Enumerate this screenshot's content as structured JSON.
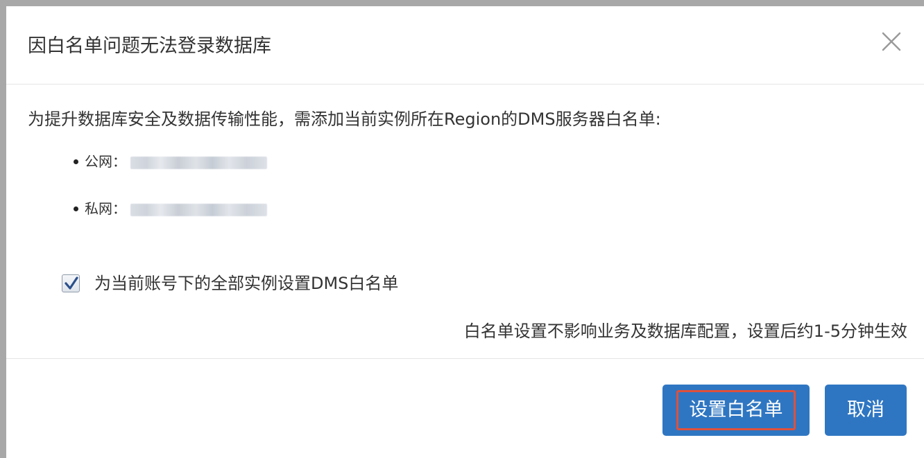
{
  "dialog": {
    "title": "因白名单问题无法登录数据库",
    "close_icon": "close-icon"
  },
  "body": {
    "intro": "为提升数据库安全及数据传输性能，需添加当前实例所在Region的DMS服务器白名单:",
    "ip_items": [
      {
        "label": "公网：",
        "value": ""
      },
      {
        "label": "私网：",
        "value": ""
      }
    ],
    "checkbox": {
      "label": "为当前账号下的全部实例设置DMS白名单",
      "checked": true
    },
    "note": "白名单设置不影响业务及数据库配置，设置后约1-5分钟生效"
  },
  "footer": {
    "confirm_label": "设置白名单",
    "cancel_label": "取消"
  },
  "colors": {
    "primary": "#2f76c2",
    "highlight": "#e0503a",
    "overlay": "#a8a8a8"
  }
}
